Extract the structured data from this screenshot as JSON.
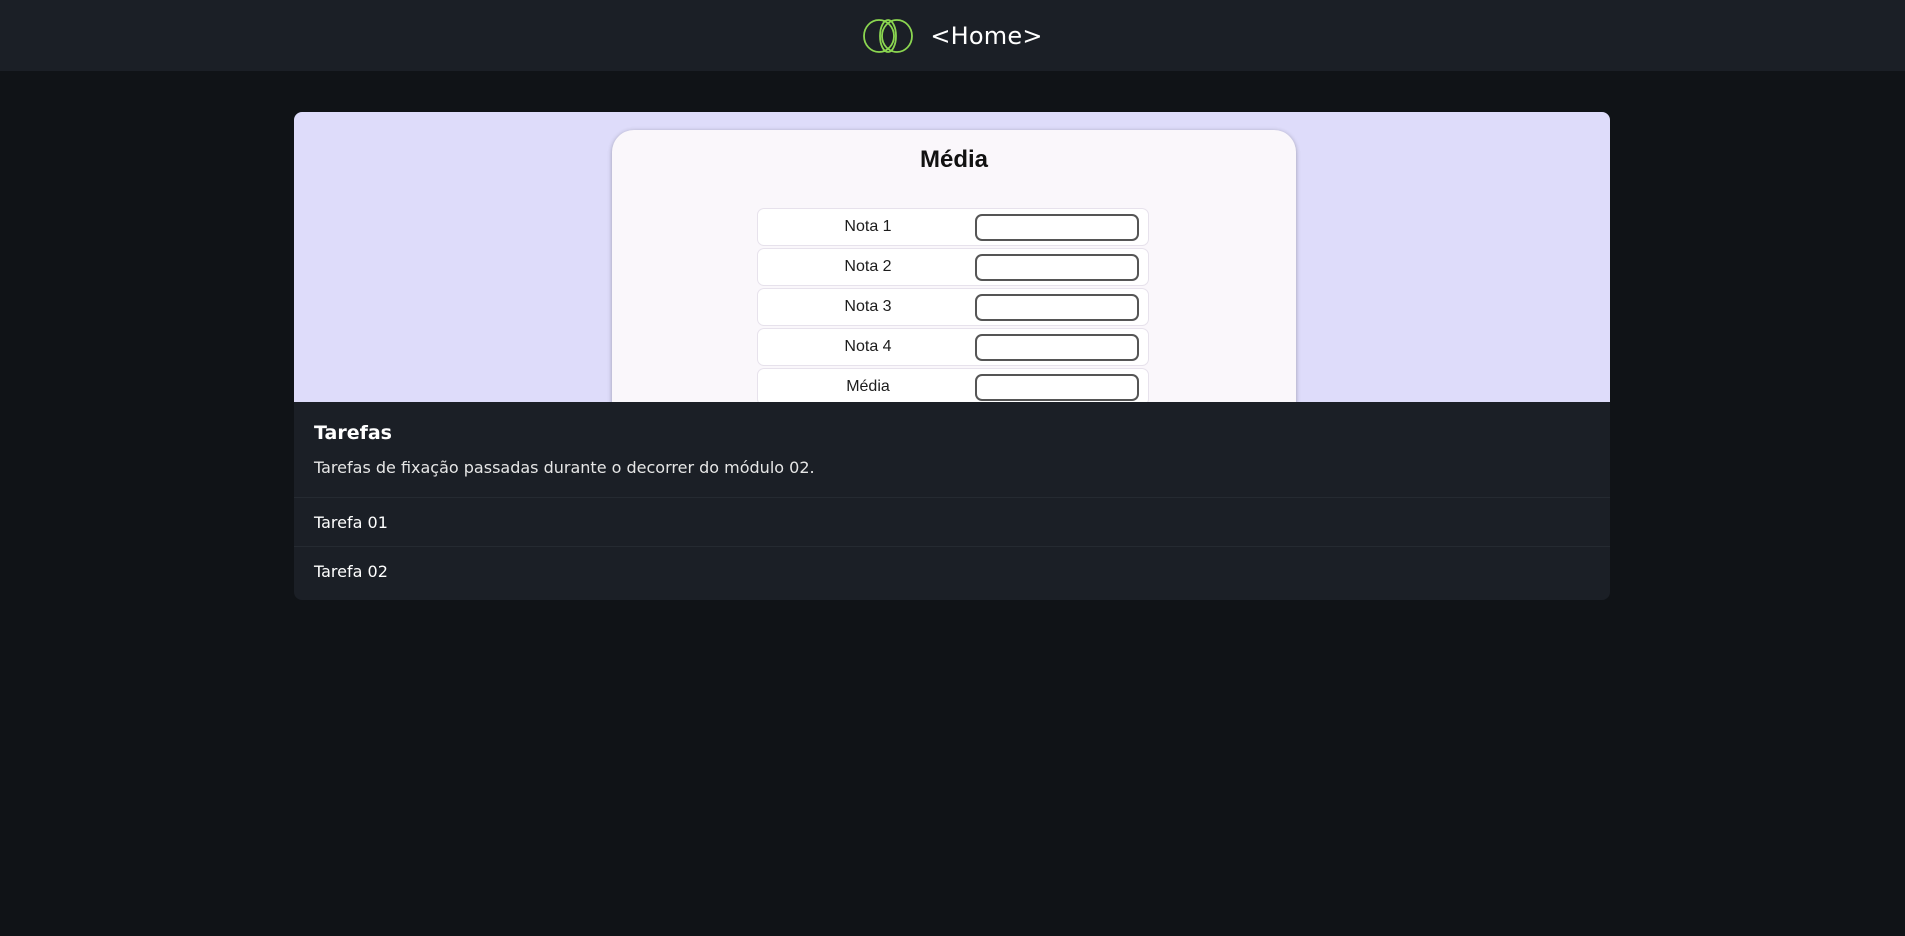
{
  "header": {
    "title": "<Home>",
    "logo_icon": "triple-ring-logo-icon",
    "accent": "#8bd650"
  },
  "card": {
    "preview": {
      "form_title": "Média",
      "rows": [
        {
          "label": "Nota 1",
          "value": ""
        },
        {
          "label": "Nota 2",
          "value": ""
        },
        {
          "label": "Nota 3",
          "value": ""
        },
        {
          "label": "Nota 4",
          "value": ""
        },
        {
          "label": "Média",
          "value": ""
        }
      ],
      "background": "#dedcfa"
    },
    "title": "Tarefas",
    "text": "Tarefas de fixação passadas durante o decorrer do módulo 02.",
    "tasks": [
      {
        "label": "Tarefa 01"
      },
      {
        "label": "Tarefa 02"
      }
    ]
  }
}
